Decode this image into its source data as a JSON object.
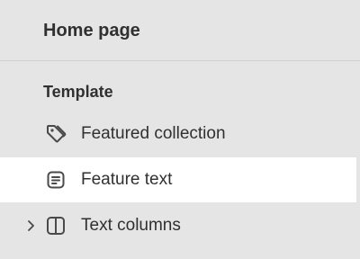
{
  "header": {
    "title": "Home page"
  },
  "template": {
    "heading": "Template",
    "items": [
      {
        "label": "Featured collection",
        "icon": "tag-icon",
        "selected": false,
        "expandable": false
      },
      {
        "label": "Feature text",
        "icon": "text-block-icon",
        "selected": true,
        "expandable": false
      },
      {
        "label": "Text columns",
        "icon": "columns-icon",
        "selected": false,
        "expandable": true
      }
    ]
  },
  "colors": {
    "background": "#e5e5e5",
    "selected_background": "#ffffff",
    "text": "#303030",
    "divider": "#cfcfcf"
  }
}
